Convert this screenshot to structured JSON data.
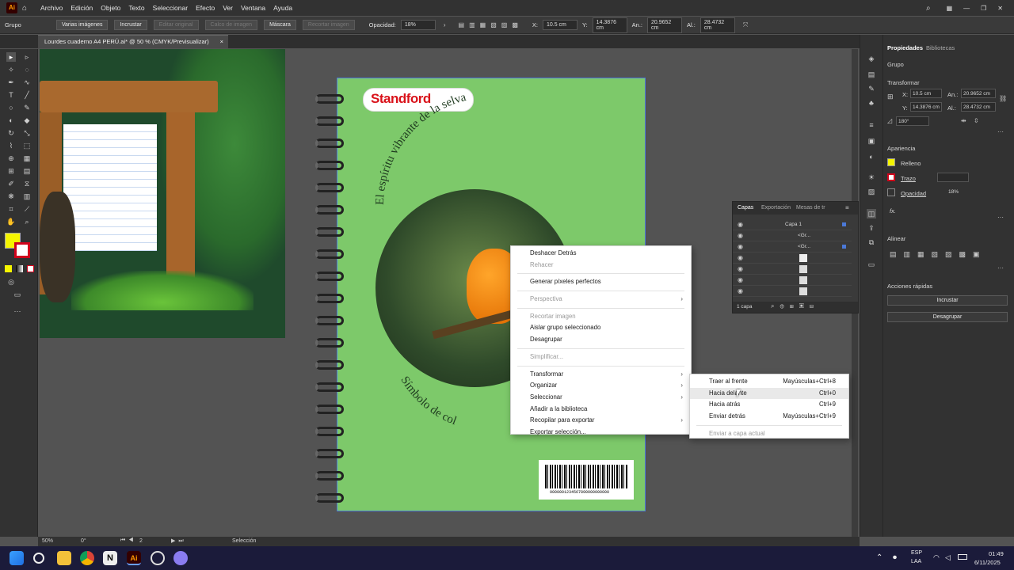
{
  "app": {
    "logo": "Ai",
    "home_icon": "home-icon"
  },
  "menubar": [
    "Archivo",
    "Edición",
    "Objeto",
    "Texto",
    "Seleccionar",
    "Efecto",
    "Ver",
    "Ventana",
    "Ayuda"
  ],
  "control_bar": {
    "selection_type": "Grupo",
    "buttons": [
      "Varias imágenes",
      "Incrustar",
      "Editar original",
      "Calco de imagen",
      "Máscara",
      "Recortar imagen"
    ],
    "disabled_buttons": [
      "Editar original",
      "Calco de imagen",
      "Recortar imagen"
    ],
    "opacity_label": "Opacidad:",
    "opacity_value": "18%",
    "x_label": "X:",
    "x_value": "10.5 cm",
    "y_label": "Y:",
    "y_value": "14.3876 cm",
    "w_label": "An.:",
    "w_value": "20.9652 cm",
    "h_label": "Al.:",
    "h_value": "28.4732 cm"
  },
  "document_tab": {
    "title": "Lourdes cuaderno A4 PERÚ.ai* @ 50 % (CMYK/Previsualizar)",
    "close": "×"
  },
  "artwork": {
    "brand": "Standford",
    "top_arc_text": "El espíritu vibrante de la selva",
    "bottom_arc_text": "Símbolo de col",
    "barcode_number": "9000001234567890000000000"
  },
  "context_menu": {
    "items": [
      {
        "label": "Deshacer Detrás",
        "enabled": true
      },
      {
        "label": "Rehacer",
        "enabled": false
      },
      {
        "sep": true
      },
      {
        "label": "Generar píxeles perfectos",
        "enabled": true
      },
      {
        "sep": true
      },
      {
        "label": "Perspectiva",
        "enabled": false,
        "submenu": true
      },
      {
        "sep": true
      },
      {
        "label": "Recortar imagen",
        "enabled": false
      },
      {
        "label": "Aislar grupo seleccionado",
        "enabled": true
      },
      {
        "label": "Desagrupar",
        "enabled": true
      },
      {
        "sep": true
      },
      {
        "label": "Simplificar...",
        "enabled": false
      },
      {
        "sep": true
      },
      {
        "label": "Transformar",
        "enabled": true,
        "submenu": true
      },
      {
        "label": "Organizar",
        "enabled": true,
        "submenu": true
      },
      {
        "label": "Seleccionar",
        "enabled": true,
        "submenu": true
      },
      {
        "label": "Añadir a la biblioteca",
        "enabled": true
      },
      {
        "label": "Recopilar para exportar",
        "enabled": true,
        "submenu": true
      },
      {
        "label": "Exportar selección...",
        "enabled": true
      }
    ]
  },
  "submenu": {
    "items": [
      {
        "label": "Traer al frente",
        "shortcut": "Mayúsculas+Ctrl+8",
        "enabled": true
      },
      {
        "label": "Hacia delante",
        "shortcut": "Ctrl+0",
        "enabled": true,
        "hover": true
      },
      {
        "label": "Hacia atrás",
        "shortcut": "Ctrl+9",
        "enabled": true
      },
      {
        "label": "Enviar detrás",
        "shortcut": "Mayúsculas+Ctrl+9",
        "enabled": true
      },
      {
        "sep": true
      },
      {
        "label": "Enviar a capa actual",
        "shortcut": "",
        "enabled": false
      }
    ]
  },
  "layers_panel": {
    "tabs": [
      "Capas",
      "Exportación",
      "Mesas de tr"
    ],
    "rows": [
      "Capa 1",
      "<Gr...",
      "<Gr...",
      "",
      "",
      "",
      ""
    ],
    "footer": "1 capa"
  },
  "properties": {
    "tabs": [
      "Propiedades",
      "Bibliotecas"
    ],
    "section": "Grupo",
    "transform_title": "Transformar",
    "x_label": "X:",
    "x_value": "10.5 cm",
    "y_label": "Y:",
    "y_value": "14.3876 cm",
    "w_label": "An.:",
    "w_value": "20.9652 cm",
    "h_label": "Al.:",
    "h_value": "28.4732 cm",
    "angle": "180°",
    "appearance_title": "Apariencia",
    "fill_label": "Relleno",
    "stroke_label": "Trazo",
    "opacity_label": "Opacidad",
    "opacity_value": "18%",
    "fx": "fx.",
    "align_title": "Alinear",
    "quick_actions_title": "Acciones rápidas",
    "quick_buttons": [
      "Incrustar",
      "Desagrupar"
    ],
    "fill_color": "#f5f500",
    "stroke_color": "#d0021b"
  },
  "status_bar": {
    "zoom": "50%",
    "rotation": "0°",
    "artboard": "2",
    "tool": "Selección"
  },
  "taskbar": {
    "lang1": "ESP",
    "lang2": "LAA",
    "time": "01:49",
    "date": "6/11/2025"
  }
}
